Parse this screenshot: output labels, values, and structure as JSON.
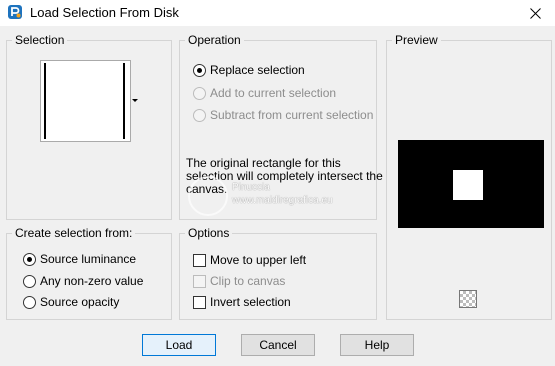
{
  "window": {
    "title": "Load Selection From Disk",
    "icon": "paintshop-pro-icon",
    "close": "×"
  },
  "selection": {
    "legend": "Selection"
  },
  "create_from": {
    "legend": "Create selection from:",
    "options": [
      {
        "label": "Source luminance",
        "checked": true
      },
      {
        "label": "Any non-zero value",
        "checked": false
      },
      {
        "label": "Source opacity",
        "checked": false
      }
    ]
  },
  "operation": {
    "legend": "Operation",
    "options": [
      {
        "label": "Replace selection",
        "checked": true,
        "enabled": true
      },
      {
        "label": "Add to current selection",
        "checked": false,
        "enabled": false
      },
      {
        "label": "Subtract from current selection",
        "checked": false,
        "enabled": false
      }
    ],
    "info": "The original rectangle for this selection will completely intersect the canvas."
  },
  "options": {
    "legend": "Options",
    "items": [
      {
        "label": "Move to upper left",
        "checked": false,
        "enabled": true
      },
      {
        "label": "Clip to canvas",
        "checked": false,
        "enabled": false
      },
      {
        "label": "Invert selection",
        "checked": false,
        "enabled": true
      }
    ]
  },
  "preview": {
    "legend": "Preview"
  },
  "buttons": {
    "load": "Load",
    "cancel": "Cancel",
    "help": "Help"
  },
  "watermark": {
    "line1": "Pinuccia",
    "line2": "www.maidiregrafica.eu"
  }
}
